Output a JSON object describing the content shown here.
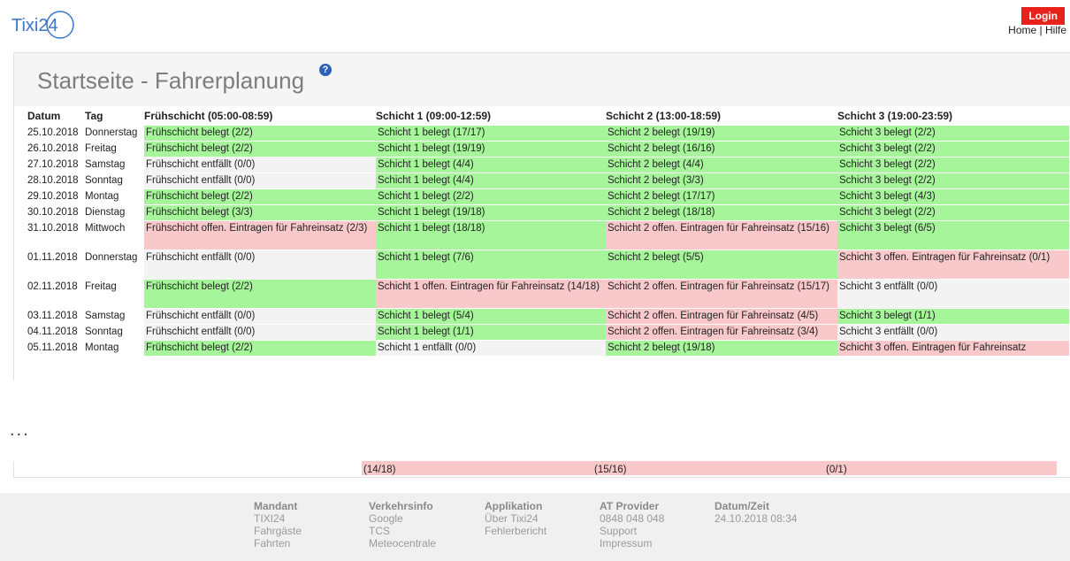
{
  "logo": {
    "text": "Tixi24",
    "icon": "tixi24-logo"
  },
  "header": {
    "login_label": "Login",
    "home_label": "Home",
    "separator": "|",
    "help_label": "Hilfe"
  },
  "page": {
    "title": "Startseite - Fahrerplanung",
    "help_icon": "question-circle-icon"
  },
  "table": {
    "headers": [
      "Datum",
      "Tag",
      "Frühschicht (05:00-08:59)",
      "Schicht 1 (09:00-12:59)",
      "Schicht 2 (13:00-18:59)",
      "Schicht 3 (19:00-23:59)"
    ],
    "rows": [
      {
        "date": "25.10.2018",
        "day": "Donnerstag",
        "s0": {
          "t": "Frühschicht belegt (2/2)",
          "c": "green"
        },
        "s1": {
          "t": "Schicht 1 belegt (17/17)",
          "c": "green"
        },
        "s2": {
          "t": "Schicht 2 belegt (19/19)",
          "c": "green"
        },
        "s3": {
          "t": "Schicht 3 belegt (2/2)",
          "c": "green"
        }
      },
      {
        "date": "26.10.2018",
        "day": "Freitag",
        "s0": {
          "t": "Frühschicht belegt (2/2)",
          "c": "green"
        },
        "s1": {
          "t": "Schicht 1 belegt (19/19)",
          "c": "green"
        },
        "s2": {
          "t": "Schicht 2 belegt (16/16)",
          "c": "green"
        },
        "s3": {
          "t": "Schicht 3 belegt (2/2)",
          "c": "green"
        }
      },
      {
        "date": "27.10.2018",
        "day": "Samstag",
        "s0": {
          "t": "Frühschicht entfällt (0/0)",
          "c": "gray"
        },
        "s1": {
          "t": "Schicht 1 belegt (4/4)",
          "c": "green"
        },
        "s2": {
          "t": "Schicht 2 belegt (4/4)",
          "c": "green"
        },
        "s3": {
          "t": "Schicht 3 belegt (2/2)",
          "c": "green"
        }
      },
      {
        "date": "28.10.2018",
        "day": "Sonntag",
        "s0": {
          "t": "Frühschicht entfällt (0/0)",
          "c": "gray"
        },
        "s1": {
          "t": "Schicht 1 belegt (4/4)",
          "c": "green"
        },
        "s2": {
          "t": "Schicht 2 belegt (3/3)",
          "c": "green"
        },
        "s3": {
          "t": "Schicht 3 belegt (2/2)",
          "c": "green"
        }
      },
      {
        "date": "29.10.2018",
        "day": "Montag",
        "s0": {
          "t": "Frühschicht belegt (2/2)",
          "c": "green"
        },
        "s1": {
          "t": "Schicht 1 belegt (2/2)",
          "c": "green"
        },
        "s2": {
          "t": "Schicht 2 belegt (17/17)",
          "c": "green"
        },
        "s3": {
          "t": "Schicht 3 belegt (4/3)",
          "c": "green"
        }
      },
      {
        "date": "30.10.2018",
        "day": "Dienstag",
        "s0": {
          "t": "Frühschicht belegt (3/3)",
          "c": "green"
        },
        "s1": {
          "t": "Schicht 1 belegt (19/18)",
          "c": "green"
        },
        "s2": {
          "t": "Schicht 2 belegt (18/18)",
          "c": "green"
        },
        "s3": {
          "t": "Schicht 3 belegt (2/2)",
          "c": "green"
        }
      },
      {
        "date": "31.10.2018",
        "day": "Mittwoch",
        "s0": {
          "t": "Frühschicht offen. Eintragen für Fahreinsatz (2/3)",
          "c": "red"
        },
        "s1": {
          "t": "Schicht 1 belegt (18/18)",
          "c": "green"
        },
        "s2": {
          "t": "Schicht 2 offen. Eintragen für Fahreinsatz (15/16)",
          "c": "red"
        },
        "s3": {
          "t": "Schicht 3 belegt (6/5)",
          "c": "green"
        }
      },
      {
        "date": "01.11.2018",
        "day": "Donnerstag",
        "s0": {
          "t": "Frühschicht entfällt (0/0)",
          "c": "gray"
        },
        "s1": {
          "t": "Schicht 1 belegt (7/6)",
          "c": "green"
        },
        "s2": {
          "t": "Schicht 2 belegt (5/5)",
          "c": "green"
        },
        "s3": {
          "t": "Schicht 3 offen. Eintragen für Fahreinsatz (0/1)",
          "c": "red"
        }
      },
      {
        "date": "02.11.2018",
        "day": "Freitag",
        "s0": {
          "t": "Frühschicht belegt (2/2)",
          "c": "green"
        },
        "s1": {
          "t": "Schicht 1 offen. Eintragen für Fahreinsatz (14/18)",
          "c": "red"
        },
        "s2": {
          "t": "Schicht 2 offen. Eintragen für Fahreinsatz (15/17)",
          "c": "red"
        },
        "s3": {
          "t": "Schicht 3 entfällt (0/0)",
          "c": "gray"
        }
      },
      {
        "date": "03.11.2018",
        "day": "Samstag",
        "s0": {
          "t": "Frühschicht entfällt (0/0)",
          "c": "gray"
        },
        "s1": {
          "t": "Schicht 1 belegt (5/4)",
          "c": "green"
        },
        "s2": {
          "t": "Schicht 2 offen. Eintragen für Fahreinsatz (4/5)",
          "c": "red"
        },
        "s3": {
          "t": "Schicht 3 belegt (1/1)",
          "c": "green"
        }
      },
      {
        "date": "04.11.2018",
        "day": "Sonntag",
        "s0": {
          "t": "Frühschicht entfällt (0/0)",
          "c": "gray"
        },
        "s1": {
          "t": "Schicht 1 belegt (1/1)",
          "c": "green"
        },
        "s2": {
          "t": "Schicht 2 offen. Eintragen für Fahreinsatz (3/4)",
          "c": "red"
        },
        "s3": {
          "t": "Schicht 3 entfällt (0/0)",
          "c": "gray"
        }
      },
      {
        "date": "05.11.2018",
        "day": "Montag",
        "s0": {
          "t": "Frühschicht belegt (2/2)",
          "c": "green"
        },
        "s1": {
          "t": "Schicht 1 entfällt (0/0)",
          "c": "gray"
        },
        "s2": {
          "t": "Schicht 2 belegt (19/18)",
          "c": "green"
        },
        "s3": {
          "t": "Schicht 3 offen. Eintragen für Fahreinsatz",
          "c": "red"
        }
      }
    ]
  },
  "ellipsis": "...",
  "fragment": {
    "s1": "(14/18)",
    "s2": "(15/16)",
    "s3": "(0/1)"
  },
  "footer": {
    "columns": [
      {
        "heading": "Mandant",
        "items": [
          "TIXI24",
          "Fahrgäste",
          "Fahrten"
        ]
      },
      {
        "heading": "Verkehrsinfo",
        "items": [
          "Google",
          "TCS",
          "Meteocentrale"
        ]
      },
      {
        "heading": "Applikation",
        "items": [
          "Über Tixi24",
          "Fehlerbericht"
        ]
      },
      {
        "heading": "AT Provider",
        "items": [
          "0848 048 048",
          "Support",
          "Impressum"
        ]
      },
      {
        "heading": "Datum/Zeit",
        "items": [
          "24.10.2018 08:34"
        ]
      }
    ]
  },
  "colors": {
    "belegt": "#a7f59b",
    "offen": "#f8c8cb",
    "entfaellt": "#f3f3f3",
    "login": "#e8211a"
  }
}
